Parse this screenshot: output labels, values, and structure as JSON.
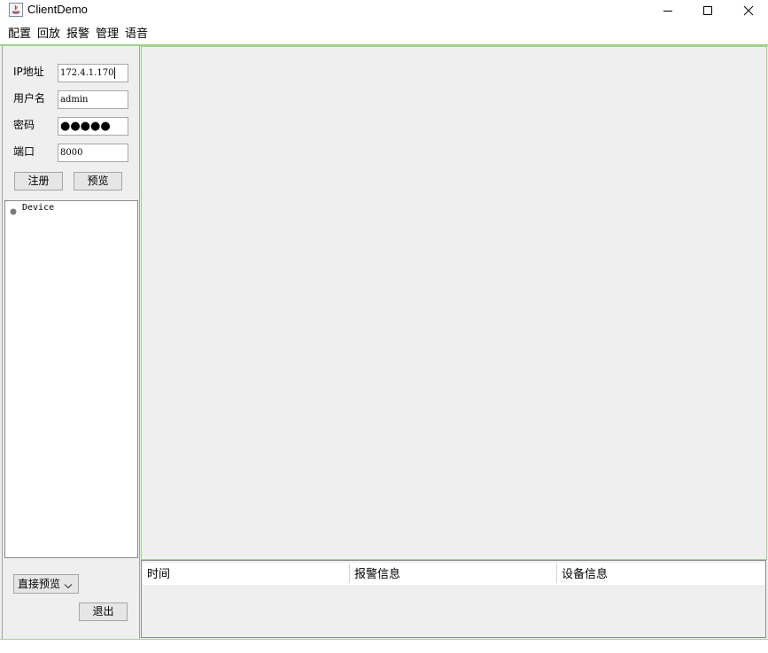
{
  "window": {
    "title": "ClientDemo",
    "icon": "java-app-icon",
    "controls": [
      "minimize-icon",
      "maximize-icon",
      "close-icon"
    ]
  },
  "menu": {
    "items": [
      {
        "label": "配置"
      },
      {
        "label": "回放"
      },
      {
        "label": "报警"
      },
      {
        "label": "管理"
      },
      {
        "label": "语音"
      }
    ]
  },
  "login": {
    "ip_label": "IP地址",
    "ip_value": "172.4.1.170",
    "user_label": "用户名",
    "user_value": "admin",
    "password_label": "密码",
    "password_value": "●●●●●",
    "port_label": "端口",
    "port_value": "8000",
    "register_label": "注册",
    "preview_label": "预览"
  },
  "tree": {
    "root_label": "Device"
  },
  "preview_mode": {
    "selected": "直接预览"
  },
  "exit_label": "退出",
  "alarm_table": {
    "columns": [
      "时间",
      "报警信息",
      "设备信息"
    ]
  },
  "colors": {
    "panel_bg": "#efefef",
    "frame_accent": "#9ed28d",
    "button_bg": "#e6e6e6"
  }
}
